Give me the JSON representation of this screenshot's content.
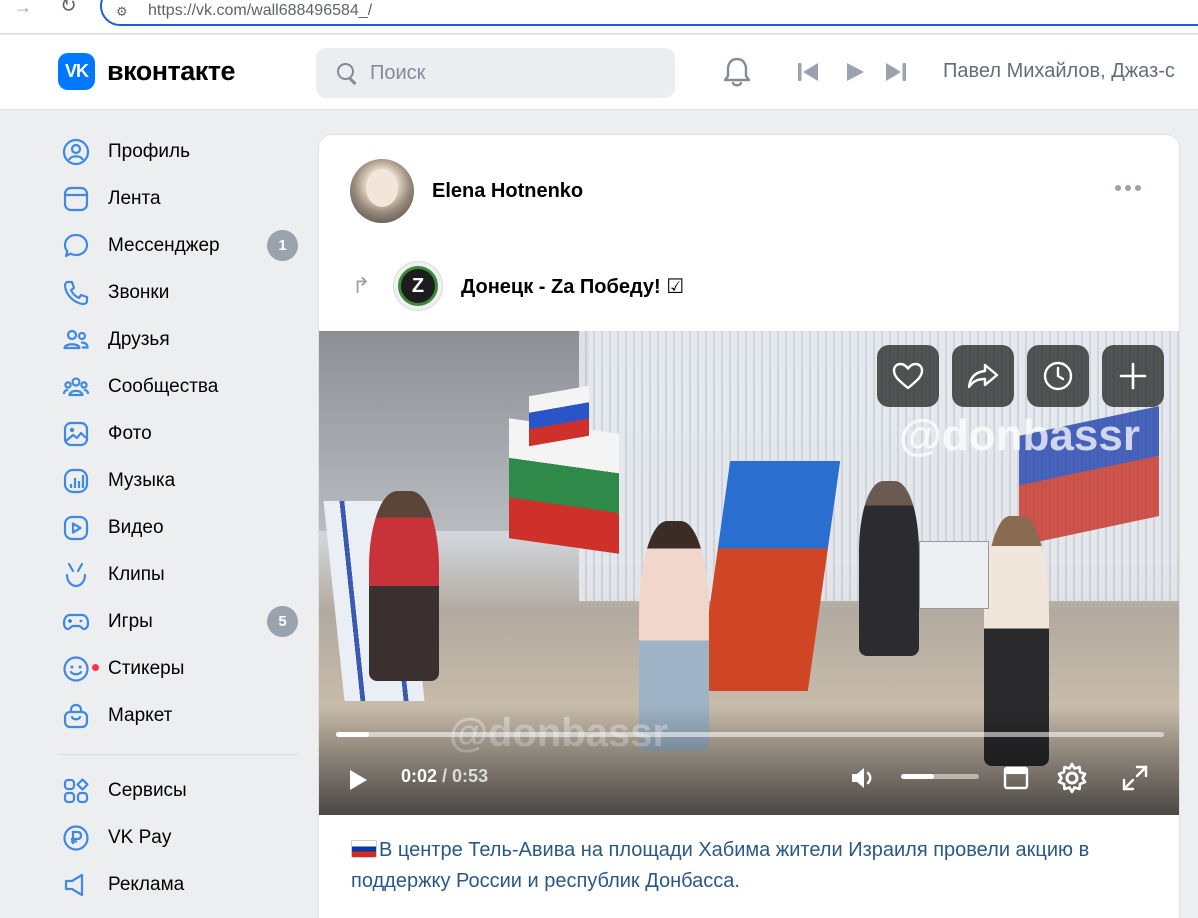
{
  "browser": {
    "url": "https://vk.com/wall688496584_/"
  },
  "header": {
    "logo_text": "вконтакте",
    "search_placeholder": "Поиск",
    "now_playing": "Павел Михайлов, Джаз-с"
  },
  "sidebar": {
    "items": [
      {
        "label": "Профиль",
        "icon": "profile-icon"
      },
      {
        "label": "Лента",
        "icon": "feed-icon"
      },
      {
        "label": "Мессенджер",
        "icon": "messenger-icon",
        "badge": "1"
      },
      {
        "label": "Звонки",
        "icon": "phone-icon"
      },
      {
        "label": "Друзья",
        "icon": "friends-icon"
      },
      {
        "label": "Сообщества",
        "icon": "communities-icon"
      },
      {
        "label": "Фото",
        "icon": "photo-icon"
      },
      {
        "label": "Музыка",
        "icon": "music-icon"
      },
      {
        "label": "Видео",
        "icon": "video-icon"
      },
      {
        "label": "Клипы",
        "icon": "clips-icon"
      },
      {
        "label": "Игры",
        "icon": "games-icon",
        "badge": "5"
      },
      {
        "label": "Стикеры",
        "icon": "stickers-icon"
      },
      {
        "label": "Маркет",
        "icon": "market-icon"
      }
    ],
    "extra_items": [
      {
        "label": "Сервисы",
        "icon": "services-icon"
      },
      {
        "label": "VK Pay",
        "icon": "vkpay-icon"
      },
      {
        "label": "Реклама",
        "icon": "ads-icon"
      }
    ]
  },
  "post": {
    "author": "Elena Hotnenko",
    "repost_group": "Донецк - Za Победу! ☑",
    "group_avatar_letter": "Z",
    "video": {
      "watermark": "@donbassr",
      "time_current": "0:02",
      "time_separator": " / ",
      "time_total": "0:53",
      "progress": 0.04,
      "volume": 0.42
    },
    "text": "В центре Тель-Авива на площади Хабима жители Израиля провели акцию в поддержку России и республик Донбасса."
  },
  "colors": {
    "accent": "#0077ff",
    "link_text": "#2a5885",
    "badge": "#99a2ad"
  }
}
